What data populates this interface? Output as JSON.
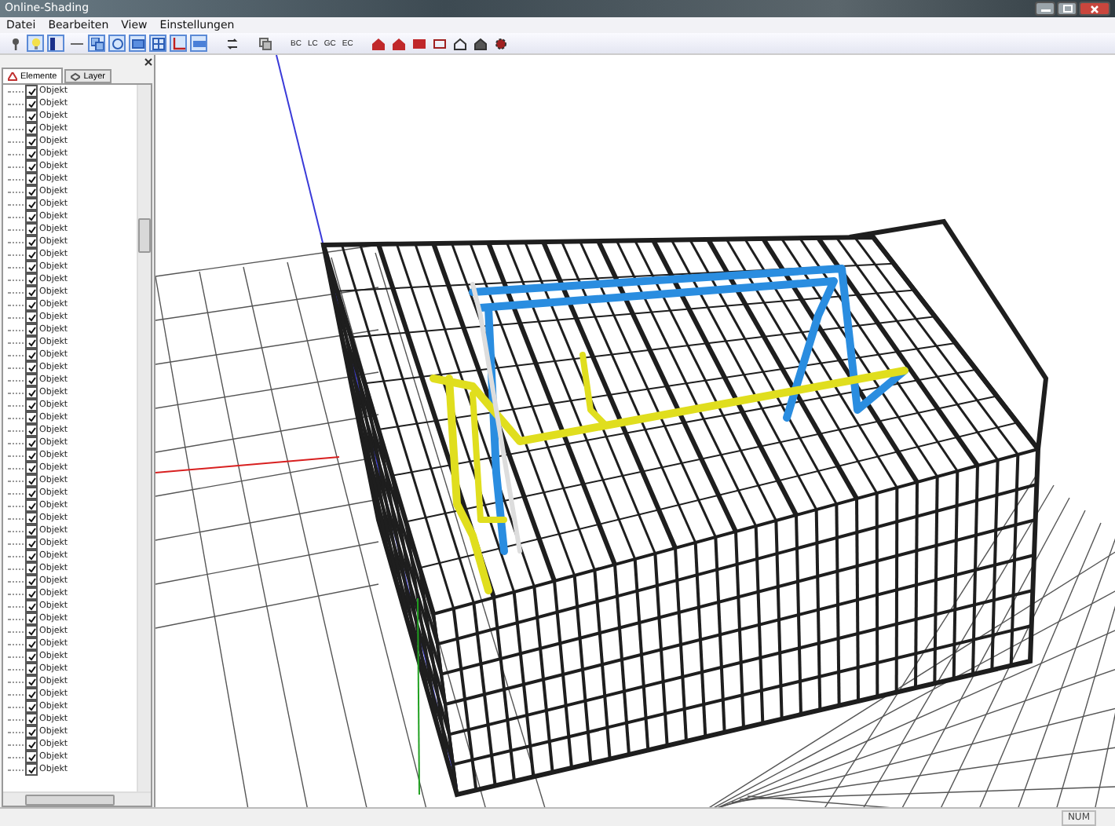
{
  "window": {
    "title": "Online-Shading"
  },
  "menu": [
    "Datei",
    "Bearbeiten",
    "View",
    "Einstellungen"
  ],
  "toolbar": {
    "text_buttons": [
      "BC",
      "LC",
      "GC",
      "EC"
    ]
  },
  "panel": {
    "tabs": [
      {
        "label": "Elemente",
        "selected": true
      },
      {
        "label": "Layer",
        "selected": false
      }
    ],
    "items": [
      {
        "label": "Objekt",
        "checked": true
      },
      {
        "label": "Objekt",
        "checked": true
      },
      {
        "label": "Objekt",
        "checked": true
      },
      {
        "label": "Objekt",
        "checked": true
      },
      {
        "label": "Objekt",
        "checked": true
      },
      {
        "label": "Objekt",
        "checked": true
      },
      {
        "label": "Objekt",
        "checked": true
      },
      {
        "label": "Objekt",
        "checked": true
      },
      {
        "label": "Objekt",
        "checked": true
      },
      {
        "label": "Objekt",
        "checked": true
      },
      {
        "label": "Objekt",
        "checked": true
      },
      {
        "label": "Objekt",
        "checked": true
      },
      {
        "label": "Objekt",
        "checked": true
      },
      {
        "label": "Objekt",
        "checked": true
      },
      {
        "label": "Objekt",
        "checked": true
      },
      {
        "label": "Objekt",
        "checked": true
      },
      {
        "label": "Objekt",
        "checked": true
      },
      {
        "label": "Objekt",
        "checked": true
      },
      {
        "label": "Objekt",
        "checked": true
      },
      {
        "label": "Objekt",
        "checked": true
      },
      {
        "label": "Objekt",
        "checked": true
      },
      {
        "label": "Objekt",
        "checked": true
      },
      {
        "label": "Objekt",
        "checked": true
      },
      {
        "label": "Objekt",
        "checked": true
      },
      {
        "label": "Objekt",
        "checked": true
      },
      {
        "label": "Objekt",
        "checked": true
      },
      {
        "label": "Objekt",
        "checked": true
      },
      {
        "label": "Objekt",
        "checked": true
      },
      {
        "label": "Objekt",
        "checked": true
      },
      {
        "label": "Objekt",
        "checked": true
      },
      {
        "label": "Objekt",
        "checked": true
      },
      {
        "label": "Objekt",
        "checked": true
      },
      {
        "label": "Objekt",
        "checked": true
      },
      {
        "label": "Objekt",
        "checked": true
      },
      {
        "label": "Objekt",
        "checked": true
      },
      {
        "label": "Objekt",
        "checked": true
      },
      {
        "label": "Objekt",
        "checked": true
      },
      {
        "label": "Objekt",
        "checked": true
      },
      {
        "label": "Objekt",
        "checked": true
      },
      {
        "label": "Objekt",
        "checked": true
      },
      {
        "label": "Objekt",
        "checked": true
      },
      {
        "label": "Objekt",
        "checked": true
      },
      {
        "label": "Objekt",
        "checked": true
      },
      {
        "label": "Objekt",
        "checked": true
      },
      {
        "label": "Objekt",
        "checked": true
      },
      {
        "label": "Objekt",
        "checked": true
      },
      {
        "label": "Objekt",
        "checked": true
      },
      {
        "label": "Objekt",
        "checked": true
      },
      {
        "label": "Objekt",
        "checked": true
      },
      {
        "label": "Objekt",
        "checked": true
      },
      {
        "label": "Objekt",
        "checked": true
      },
      {
        "label": "Objekt",
        "checked": true
      },
      {
        "label": "Objekt",
        "checked": true
      },
      {
        "label": "Objekt",
        "checked": true
      },
      {
        "label": "Objekt",
        "checked": true
      }
    ]
  },
  "status_bar": {
    "indicator": "NUM"
  }
}
